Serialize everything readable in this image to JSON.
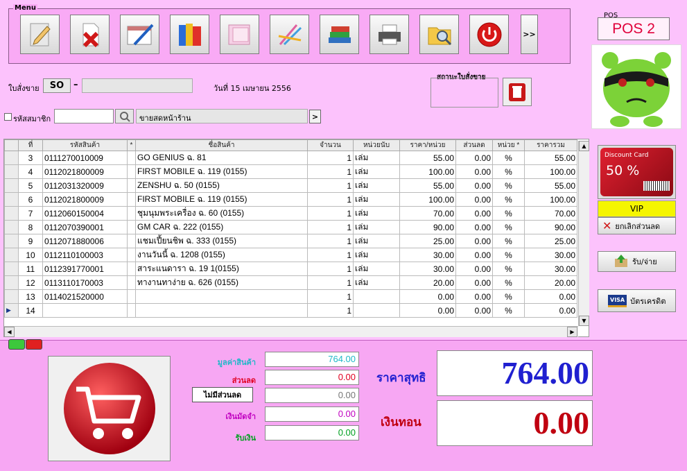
{
  "menu": {
    "title": "Menu",
    "buttons": [
      {
        "name": "edit-icon"
      },
      {
        "name": "delete-icon"
      },
      {
        "name": "calendar-icon"
      },
      {
        "name": "books-icon"
      },
      {
        "name": "notes-icon"
      },
      {
        "name": "stationery-icon"
      },
      {
        "name": "stack-books-icon"
      },
      {
        "name": "printer-icon"
      },
      {
        "name": "folder-search-icon"
      },
      {
        "name": "power-icon"
      }
    ],
    "more_label": ">>"
  },
  "pos": {
    "caption": "POS",
    "value": "POS 2"
  },
  "order": {
    "label": "ใบสั่งขาย",
    "prefix": "SO",
    "dash": "–",
    "number": "",
    "date": "วันที่ 15 เมษายน 2556"
  },
  "status": {
    "caption": "สถานะใบสั่งขาย"
  },
  "member": {
    "label": "รหัสสมาชิก",
    "code": "",
    "name": "ขายสดหน้าร้าน",
    "go": ">"
  },
  "grid": {
    "columns": [
      "ที่",
      "รหัสสินค้า",
      "*",
      "ชื่อสินค้า",
      "จำนวน",
      "หน่วยนับ",
      "ราคา/หน่วย",
      "ส่วนลด",
      "หน่วย *",
      "ราคารวม"
    ],
    "rows": [
      [
        "3",
        "0111270010009",
        "GO GENIUS ฉ. 81",
        "1",
        "เล่ม",
        "55.00",
        "0.00",
        "%",
        "55.00"
      ],
      [
        "4",
        "0112021800009",
        "FIRST MOBILE ฉ. 119 (0155)",
        "1",
        "เล่ม",
        "100.00",
        "0.00",
        "%",
        "100.00"
      ],
      [
        "5",
        "0112031320009",
        "ZENSHU ฉ. 50 (0155)",
        "1",
        "เล่ม",
        "55.00",
        "0.00",
        "%",
        "55.00"
      ],
      [
        "6",
        "0112021800009",
        "FIRST MOBILE ฉ. 119 (0155)",
        "1",
        "เล่ม",
        "100.00",
        "0.00",
        "%",
        "100.00"
      ],
      [
        "7",
        "0112060150004",
        "ชุมนุมพระเครื่อง ฉ. 60 (0155)",
        "1",
        "เล่ม",
        "70.00",
        "0.00",
        "%",
        "70.00"
      ],
      [
        "8",
        "0112070390001",
        "GM CAR ฉ. 222 (0155)",
        "1",
        "เล่ม",
        "90.00",
        "0.00",
        "%",
        "90.00"
      ],
      [
        "9",
        "0112071880006",
        "แชมเปี้ยนชิพ ฉ. 333 (0155)",
        "1",
        "เล่ม",
        "25.00",
        "0.00",
        "%",
        "25.00"
      ],
      [
        "10",
        "0112110100003",
        "งานวันนี้ ฉ. 1208 (0155)",
        "1",
        "เล่ม",
        "30.00",
        "0.00",
        "%",
        "30.00"
      ],
      [
        "11",
        "0112391770001",
        "สาระแนดารา ฉ. 19 1(0155)",
        "1",
        "เล่ม",
        "30.00",
        "0.00",
        "%",
        "30.00"
      ],
      [
        "12",
        "0113110170003",
        "ทางานทาง่าย ฉ. 626 (0155)",
        "1",
        "เล่ม",
        "20.00",
        "0.00",
        "%",
        "20.00"
      ],
      [
        "13",
        "0114021520000",
        "",
        "1",
        "",
        "0.00",
        "0.00",
        "%",
        "0.00"
      ],
      [
        "14",
        "",
        "",
        "1",
        "",
        "0.00",
        "0.00",
        "%",
        "0.00"
      ]
    ]
  },
  "side": {
    "card_title": "Discount Card",
    "card_percent": "50 %",
    "vip": "VIP",
    "cancel_discount": "ยกเลิกส่วนลด",
    "receive_pay": "รับ/จ่าย",
    "credit_card": "บัตรเครดิต",
    "visa": "VISA"
  },
  "summary": {
    "goods_value_label": "มูลค่าสินค้า",
    "goods_value": "764.00",
    "discount_label": "ส่วนลด",
    "discount": "0.00",
    "no_discount": "ไม่มีส่วนลด",
    "no_discount_value": "0.00",
    "deposit_label": "เงินมัดจำ",
    "deposit": "0.00",
    "received_label": "รับเงิน",
    "received": "0.00",
    "net_label": "ราคาสุทธิ",
    "net": "764.00",
    "change_label": "เงินทอน",
    "change": "0.00"
  },
  "colors": {
    "goods": "#20b8c8",
    "discount": "#e00020",
    "deposit": "#c000c0",
    "received": "#00a020",
    "net": "#2020d0",
    "change": "#c00010"
  }
}
